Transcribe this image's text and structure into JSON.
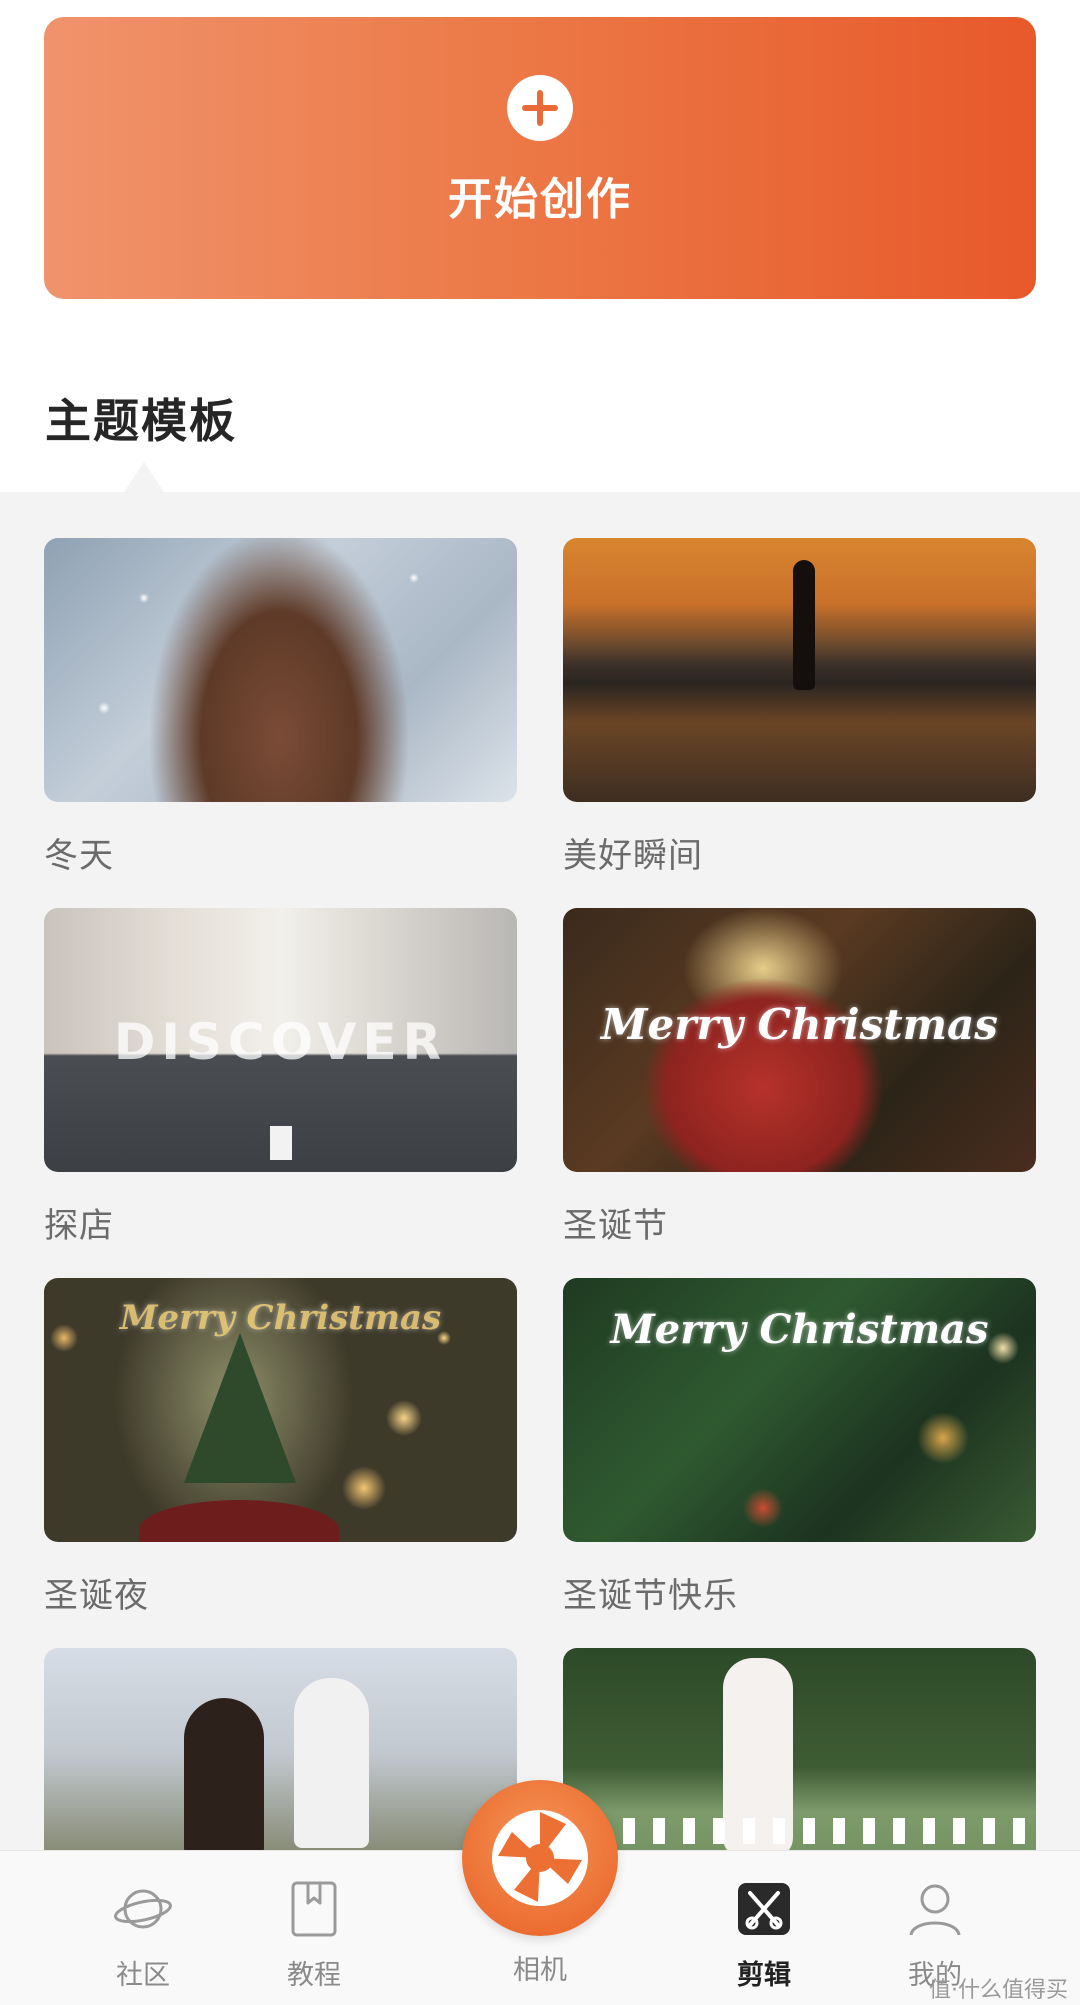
{
  "create": {
    "label": "开始创作"
  },
  "section": {
    "title": "主题模板"
  },
  "templates": [
    {
      "label": "冬天"
    },
    {
      "label": "美好瞬间"
    },
    {
      "label": "探店",
      "overlay": "DISCOVER"
    },
    {
      "label": "圣诞节",
      "overlay": "Merry Christmas"
    },
    {
      "label": "圣诞夜",
      "overlay": "Merry Christmas"
    },
    {
      "label": "圣诞节快乐",
      "overlay": "Merry Christmas"
    },
    {
      "label": ""
    },
    {
      "label": ""
    }
  ],
  "nav": {
    "items": [
      {
        "label": "社区",
        "icon": "planet-icon"
      },
      {
        "label": "教程",
        "icon": "book-icon"
      },
      {
        "label": "相机",
        "icon": "camera-shutter-icon"
      },
      {
        "label": "剪辑",
        "icon": "scissors-icon"
      },
      {
        "label": "我的",
        "icon": "user-icon"
      }
    ],
    "active": "剪辑"
  },
  "watermark": "值·什么值得买",
  "colors": {
    "accent": "#ec6f33",
    "grid_background": "#f3f3f4"
  }
}
